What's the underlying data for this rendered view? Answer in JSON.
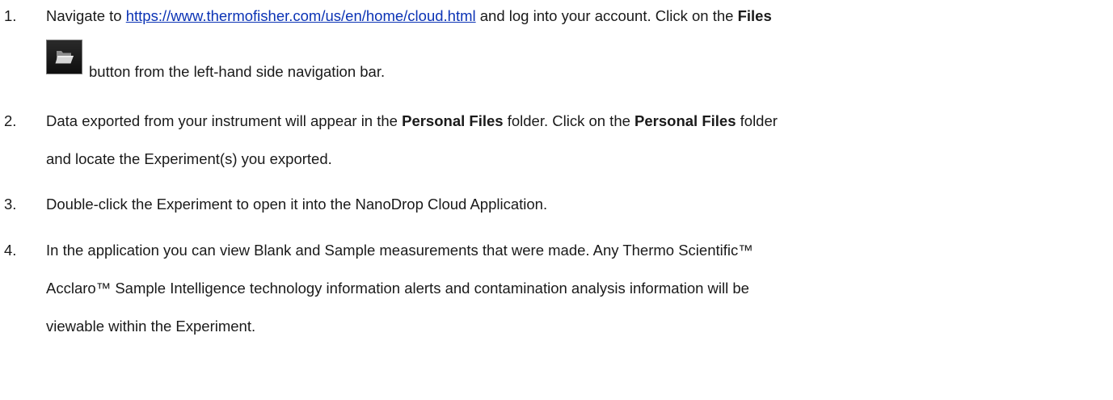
{
  "steps": [
    {
      "number": "1.",
      "line1_pre": "Navigate to ",
      "link_text": "https://www.thermofisher.com/us/en/home/cloud.html",
      "line1_mid": " and log into your account. Click on the ",
      "line1_bold": "Files",
      "line2": "button from the left-hand side navigation bar."
    },
    {
      "number": "2.",
      "line1_pre": "Data exported from your instrument will appear in the ",
      "bold1": "Personal Files",
      "line1_mid": " folder. Click on the ",
      "bold2": "Personal Files",
      "line1_post": " folder",
      "line2": "and locate the Experiment(s) you exported."
    },
    {
      "number": "3.",
      "line1": "Double-click the Experiment to open it into the NanoDrop Cloud Application."
    },
    {
      "number": "4.",
      "line1": "In the application you can view Blank and Sample measurements that were made. Any Thermo Scientific™",
      "line2": "Acclaro™ Sample Intelligence technology information alerts and contamination analysis information will be",
      "line3": "viewable within the Experiment."
    }
  ],
  "icons": {
    "files_button_icon": "folder-open-icon"
  }
}
